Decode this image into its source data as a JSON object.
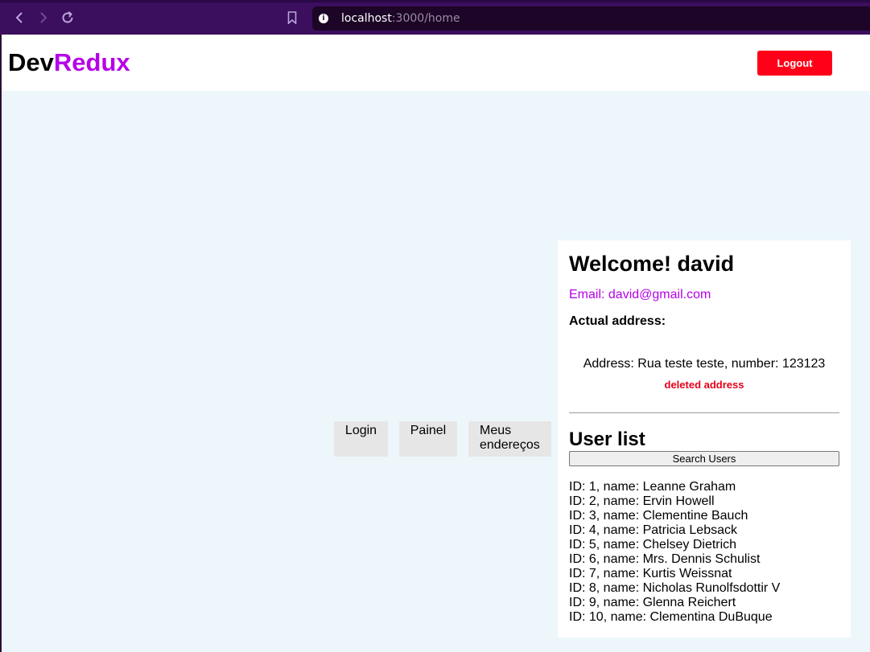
{
  "browser": {
    "url_host": "localhost",
    "url_rest": ":3000/home"
  },
  "header": {
    "logo_part1": "Dev",
    "logo_part2": "Redux",
    "logout_label": "Logout"
  },
  "menu": {
    "login_label": "Login",
    "painel_label": "Painel",
    "enderecos_line1": "Meus",
    "enderecos_line2": "endereços"
  },
  "profile": {
    "welcome": "Welcome! david",
    "email": "Email: david@gmail.com",
    "actual_address_label": "Actual address:",
    "address_text": "Address: Rua teste teste, number: 123123",
    "deleted_label": "deleted address"
  },
  "user_list": {
    "title": "User list",
    "search_label": "Search Users",
    "users": [
      "ID: 1, name: Leanne Graham",
      "ID: 2, name: Ervin Howell",
      "ID: 3, name: Clementine Bauch",
      "ID: 4, name: Patricia Lebsack",
      "ID: 5, name: Chelsey Dietrich",
      "ID: 6, name: Mrs. Dennis Schulist",
      "ID: 7, name: Kurtis Weissnat",
      "ID: 8, name: Nicholas Runolfsdottir V",
      "ID: 9, name: Glenna Reichert",
      "ID: 10, name: Clementina DuBuque"
    ]
  },
  "colors": {
    "accent": "#b600e8",
    "logout_bg": "#ff0018",
    "page_bg": "#edf7fb",
    "chrome_bg": "#3b0e5e"
  },
  "icons": [
    "back-arrow-icon",
    "forward-arrow-icon",
    "reload-icon",
    "bookmark-icon",
    "info-icon"
  ]
}
